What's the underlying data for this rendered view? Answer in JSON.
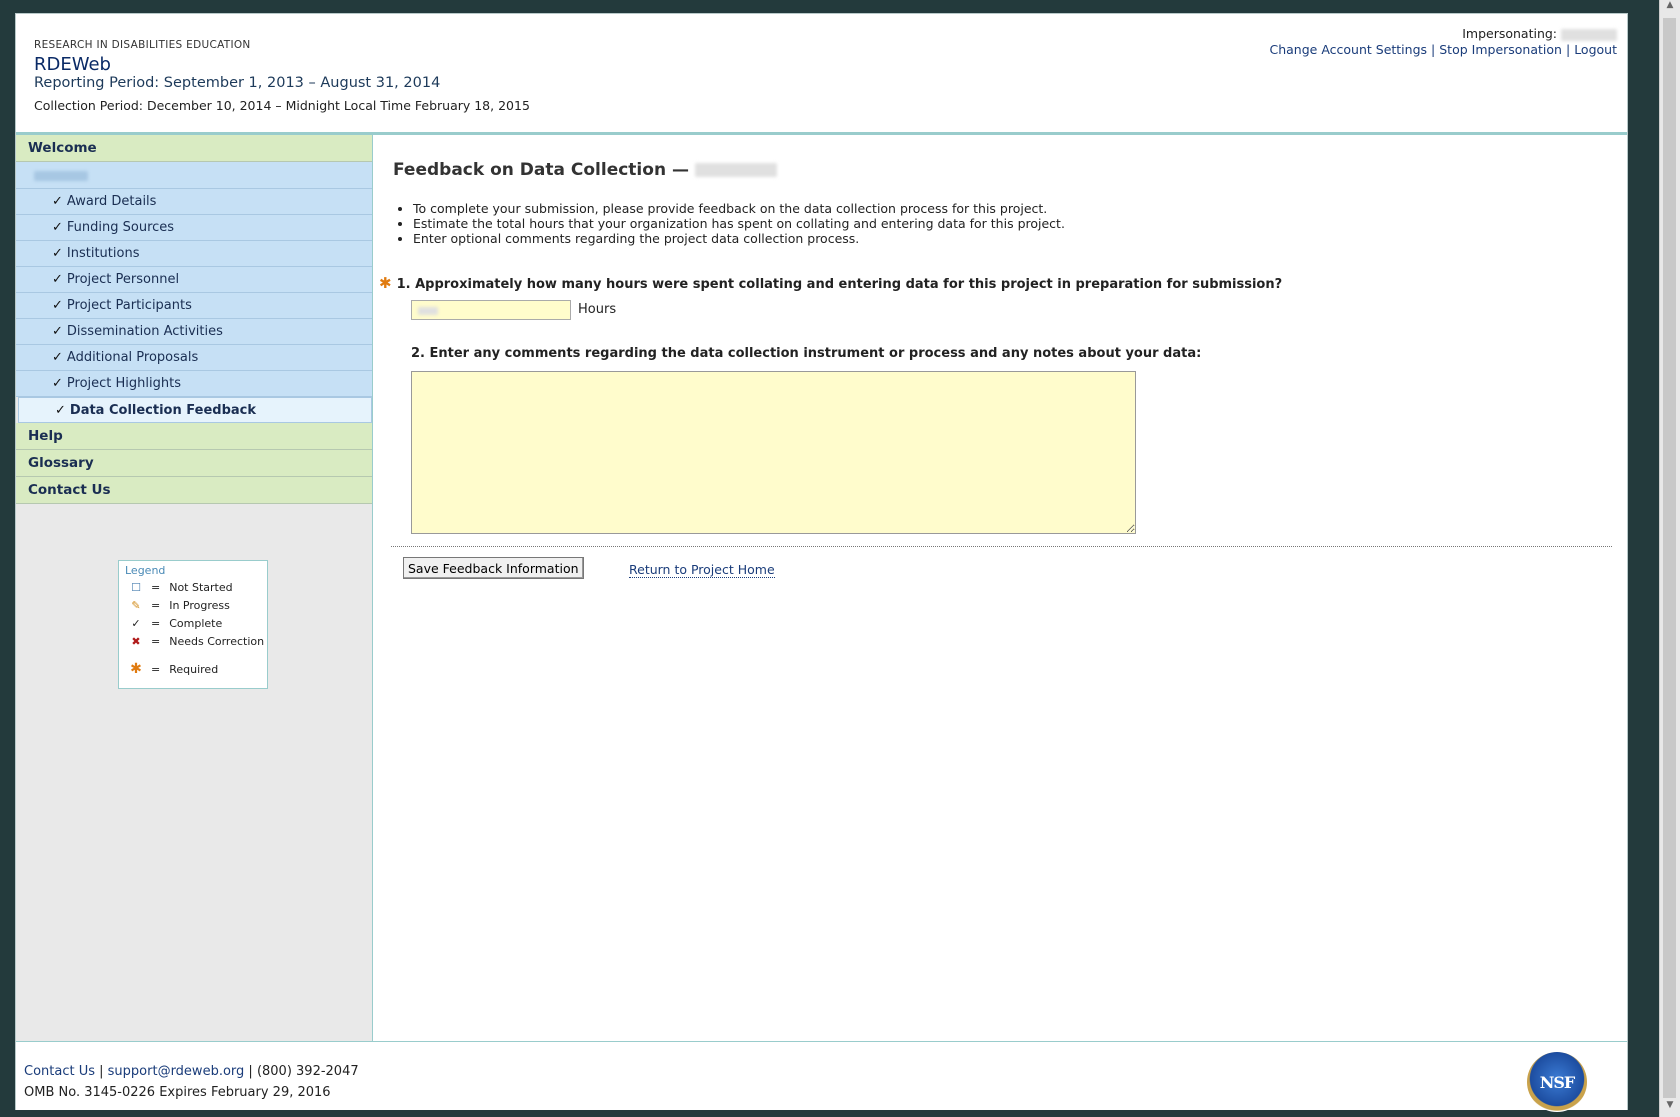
{
  "header": {
    "org": "RESEARCH IN DISABILITIES EDUCATION",
    "app_name": "RDEWeb",
    "reporting_period": "Reporting Period: September 1, 2013 – August 31, 2014",
    "collection_period": "Collection Period: December 10, 2014 – Midnight Local Time February 18, 2015",
    "impersonating_label": "Impersonating:",
    "links": [
      "Change Account Settings",
      "Stop Impersonation",
      "Logout"
    ]
  },
  "sidebar": {
    "welcome": "Welcome",
    "items": [
      {
        "label": "Award Details",
        "status": "complete"
      },
      {
        "label": "Funding Sources",
        "status": "complete"
      },
      {
        "label": "Institutions",
        "status": "complete"
      },
      {
        "label": "Project Personnel",
        "status": "complete"
      },
      {
        "label": "Project Participants",
        "status": "complete"
      },
      {
        "label": "Dissemination Activities",
        "status": "complete"
      },
      {
        "label": "Additional Proposals",
        "status": "complete"
      },
      {
        "label": "Project Highlights",
        "status": "complete"
      },
      {
        "label": "Data Collection Feedback",
        "status": "complete",
        "active": true
      }
    ],
    "help": "Help",
    "glossary": "Glossary",
    "contact": "Contact Us"
  },
  "legend": {
    "title": "Legend",
    "eq": "=",
    "rows": [
      "Not Started",
      "In Progress",
      "Complete",
      "Needs Correction",
      "Required"
    ]
  },
  "main": {
    "title": "Feedback on Data Collection —",
    "instructions": [
      "To complete your submission, please provide feedback on the data collection process for this project.",
      "Estimate the total hours that your organization has spent on collating and entering data for this project.",
      "Enter optional comments regarding the project data collection process."
    ],
    "q1": "1. Approximately how many hours were spent collating and entering data for this project in preparation for submission?",
    "hours_label": "Hours",
    "q2": "2. Enter any comments regarding the data collection instrument or process and any notes about your data:",
    "save_button": "Save Feedback Information",
    "return_link": "Return to Project Home"
  },
  "footer": {
    "contact_link": "Contact Us",
    "email": "support@rdeweb.org",
    "phone": "(800) 392-2047",
    "omb": "OMB No. 3145-0226 Expires February 29, 2016",
    "logo_text": "NSF"
  },
  "colors": {
    "nav_green": "#d9ebc2",
    "nav_blue": "#c6e0f5",
    "input_yellow": "#fffccc",
    "required_orange": "#e07b10"
  }
}
